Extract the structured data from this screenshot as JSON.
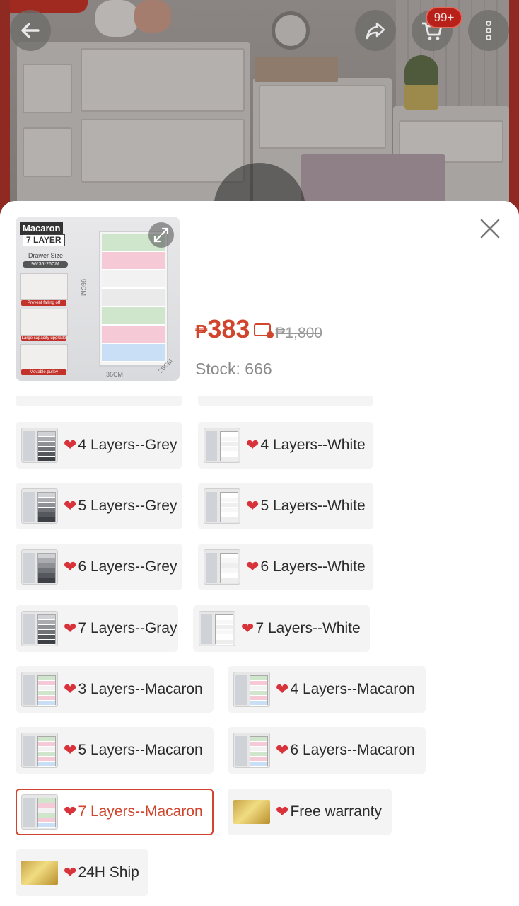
{
  "topbar": {
    "cart_badge": "99+"
  },
  "product_image": {
    "label_brand": "Macaron",
    "label_layers": "7 LAYER",
    "label_size_title": "Drawer Size",
    "label_size": "96*36*26CM",
    "tag_1": "Prevent falling off",
    "tag_2": "Large capacity upgrade",
    "tag_3": "Movable pulley",
    "dim_height": "96CM",
    "dim_width": "36CM",
    "dim_depth": "26CM"
  },
  "price": {
    "currency": "₱",
    "current": "383",
    "original": "₱1,800"
  },
  "stock": "Stock: 666",
  "options": [
    {
      "label": "4 Layers--Grey",
      "tone": "grey",
      "selected": false
    },
    {
      "label": "4 Layers--White",
      "tone": "white",
      "selected": false
    },
    {
      "label": "5 Layers--Grey",
      "tone": "grey",
      "selected": false
    },
    {
      "label": "5 Layers--White",
      "tone": "white",
      "selected": false
    },
    {
      "label": "6 Layers--Grey",
      "tone": "grey",
      "selected": false
    },
    {
      "label": "6 Layers--White",
      "tone": "white",
      "selected": false
    },
    {
      "label": "7 Layers--Gray",
      "tone": "grey",
      "selected": false
    },
    {
      "label": "7 Layers--White",
      "tone": "white",
      "selected": false
    },
    {
      "label": "3 Layers--Macaron",
      "tone": "macaron",
      "selected": false
    },
    {
      "label": "4 Layers--Macaron",
      "tone": "macaron",
      "selected": false
    },
    {
      "label": "5 Layers--Macaron",
      "tone": "macaron",
      "selected": false
    },
    {
      "label": "6 Layers--Macaron",
      "tone": "macaron",
      "selected": false
    },
    {
      "label": "7 Layers--Macaron",
      "tone": "macaron",
      "selected": true
    },
    {
      "label": "Free warranty",
      "tone": "gold",
      "selected": false
    },
    {
      "label": "24H Ship",
      "tone": "gold",
      "selected": false
    }
  ],
  "colors": {
    "accent": "#d0452c",
    "heart": "#d8323a",
    "chip_bg": "#f4f4f4"
  }
}
